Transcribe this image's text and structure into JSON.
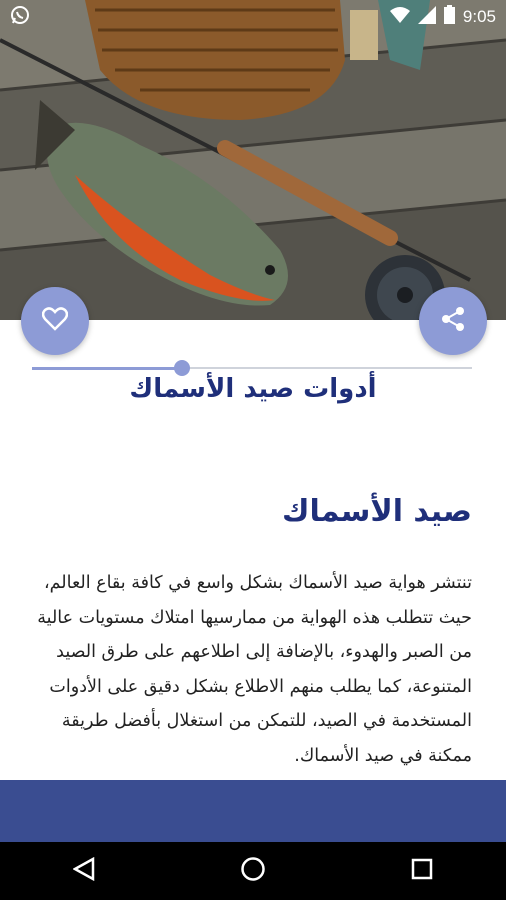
{
  "status_bar": {
    "time": "9:05",
    "icons": [
      "whatsapp-icon",
      "wifi-icon",
      "signal-icon",
      "battery-icon"
    ]
  },
  "hero": {
    "description_icon": "fishing-gear-photo"
  },
  "actions": {
    "favorite_icon": "heart-icon",
    "share_icon": "share-icon"
  },
  "article": {
    "title": "أدوات صيد الأسماك",
    "progress": 0.34,
    "section_heading": "صيد الأسماك",
    "paragraph": "تنتشر هواية صيد الأسماك بشكل واسع في كافة بقاع العالم، حيث تتطلب هذه الهواية من ممارسيها امتلاك مستويات عالية من الصبر والهدوء، بالإضافة إلى اطلاعهم على طرق الصيد المتنوعة، كما يطلب منهم الاطلاع بشكل دقيق على الأدوات المستخدمة في الصيد، للتمكن من استغلال بأفضل طريقة ممكنة في صيد الأسماك."
  },
  "colors": {
    "accent": "#8d9bd6",
    "title": "#1f2f7a",
    "footer": "#3a4d91"
  },
  "nav": {
    "buttons": [
      "back-icon",
      "home-icon",
      "recents-icon"
    ]
  }
}
